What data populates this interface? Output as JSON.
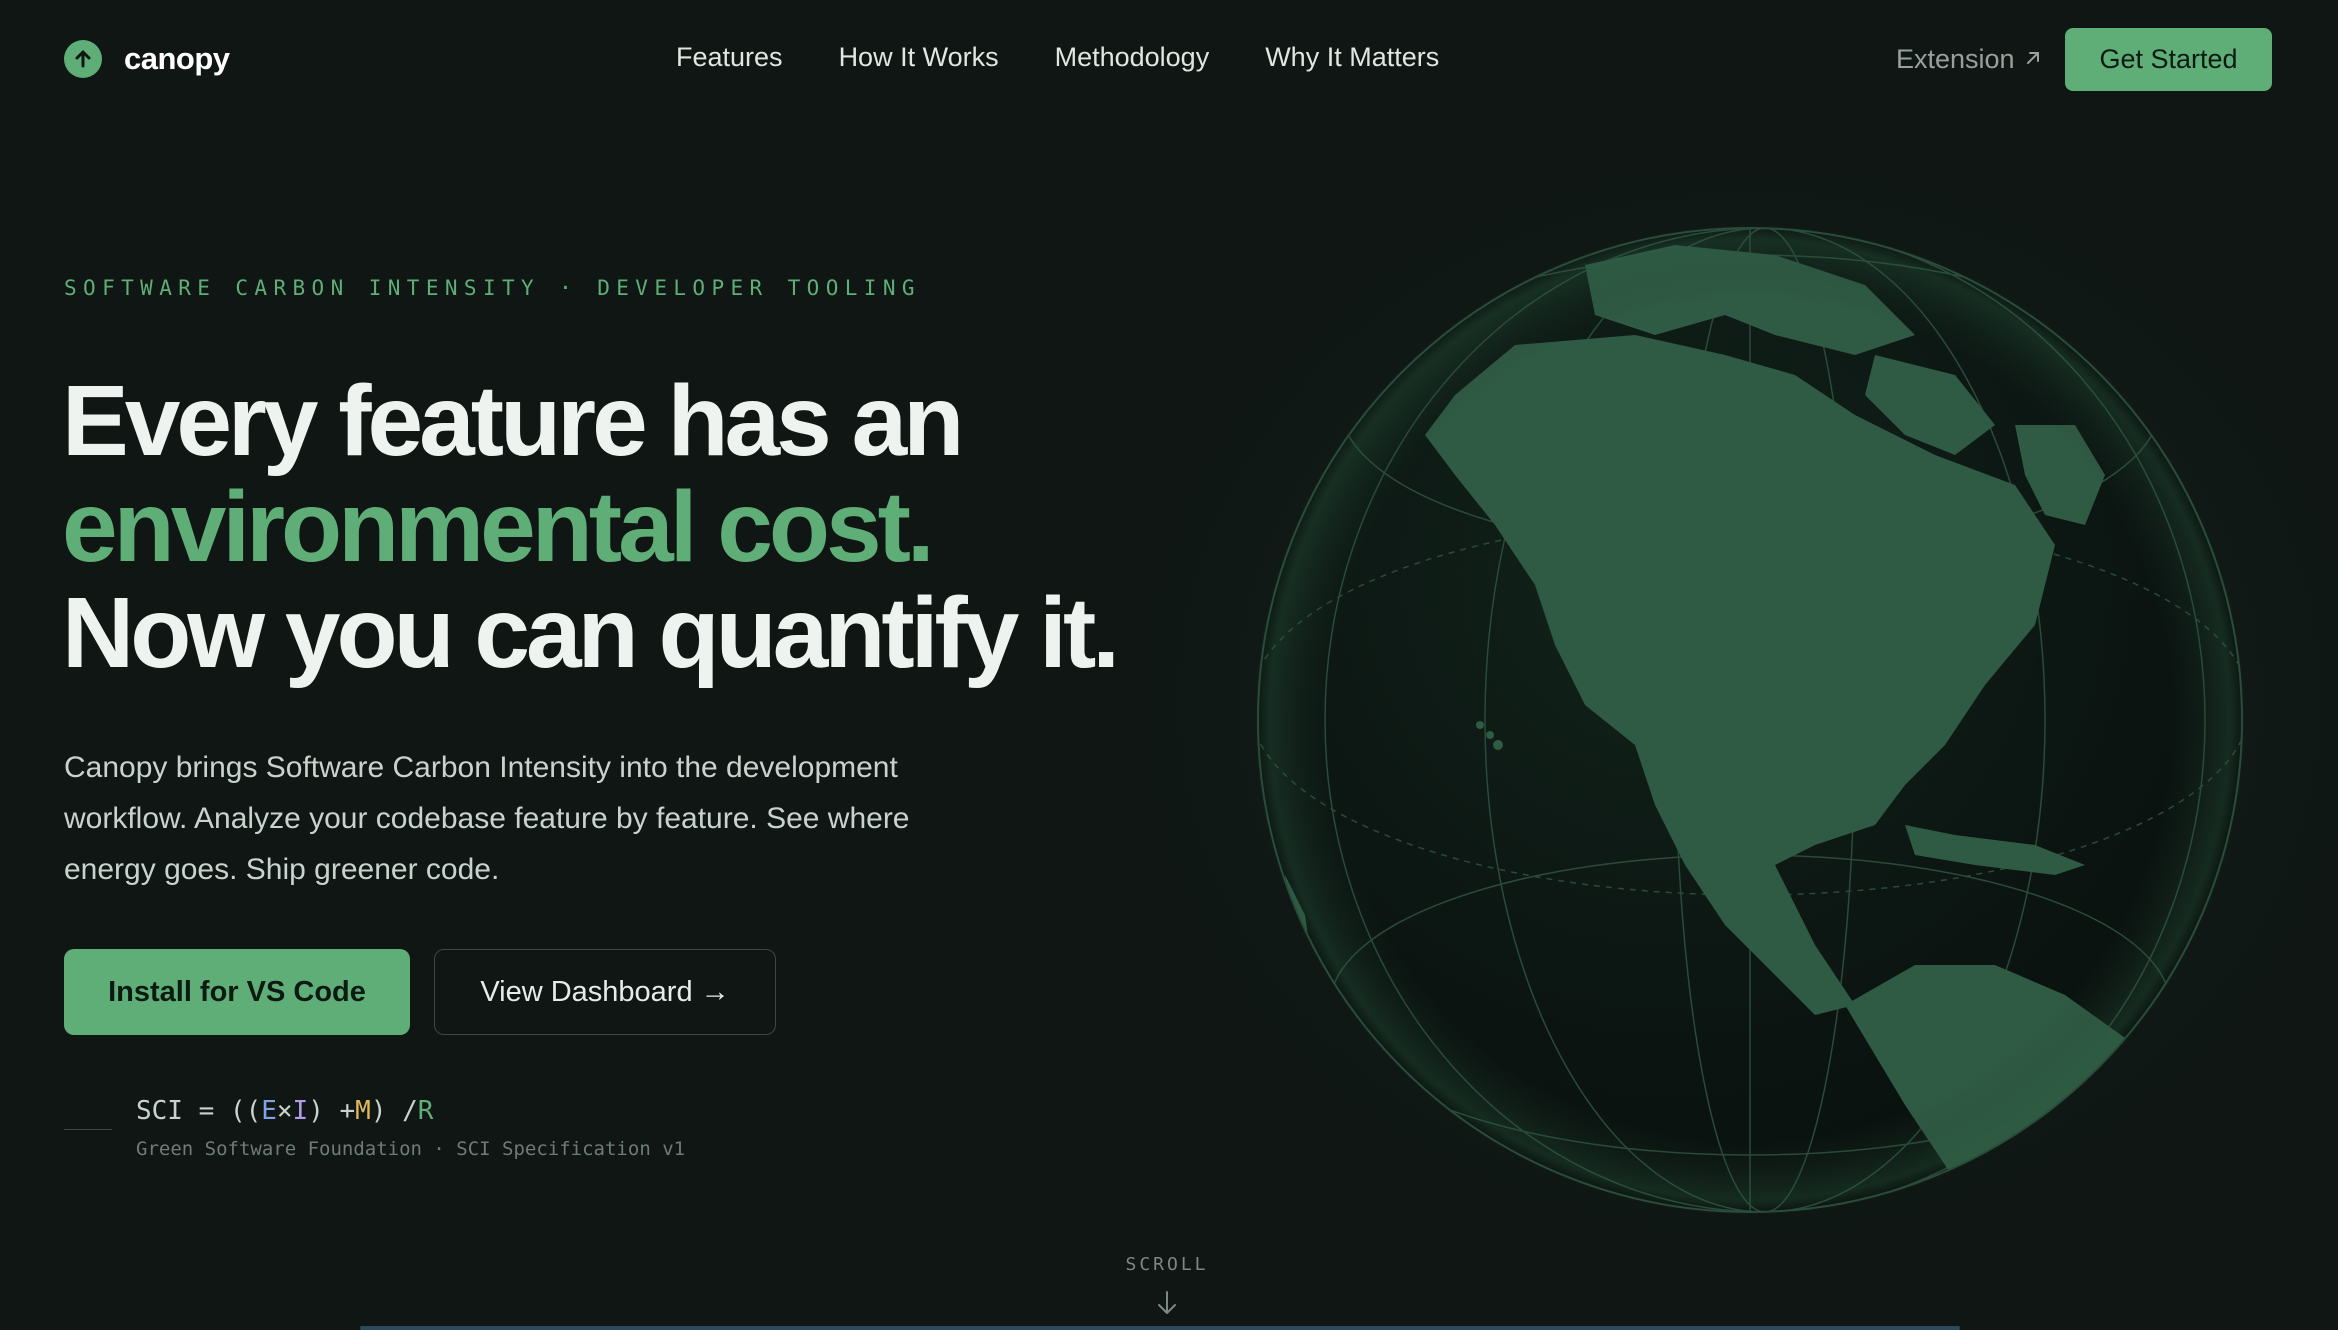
{
  "brand": {
    "name": "canopy"
  },
  "nav": {
    "links": [
      "Features",
      "How It Works",
      "Methodology",
      "Why It Matters"
    ],
    "extension_label": "Extension",
    "cta_label": "Get Started"
  },
  "hero": {
    "eyebrow": "SOFTWARE CARBON INTENSITY · DEVELOPER TOOLING",
    "headline_line1": "Every feature has an",
    "headline_line2": "environmental cost.",
    "headline_line3": "Now you can quantify it.",
    "subtitle": "Canopy brings Software Carbon Intensity into the development workflow. Analyze your codebase feature by feature. See where energy goes. Ship greener code.",
    "primary_button": "Install for VS Code",
    "secondary_button": "View Dashboard →"
  },
  "formula": {
    "prefix": "SCI = ((",
    "e": "E",
    "times": "×",
    "i": "I",
    "plus": ") +",
    "m": "M",
    "div": ") /",
    "r": "R",
    "note": "Green Software Foundation · SCI Specification v1"
  },
  "scroll": {
    "label": "SCROLL"
  },
  "colors": {
    "accent": "#5fae78",
    "background": "#0f1614",
    "text": "#eef3ef"
  },
  "icons": {
    "logo": "arrow-up-circle-icon",
    "extension": "arrow-up-right-icon",
    "scroll": "arrow-down-icon",
    "globe": "globe-icon"
  }
}
